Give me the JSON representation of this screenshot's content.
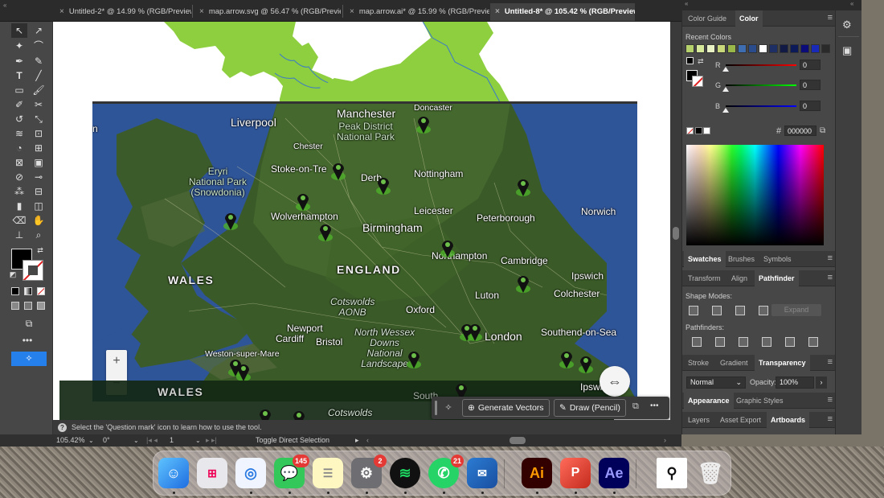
{
  "tabs": [
    {
      "label": "Untitled-2* @ 14.99 % (RGB/Preview)",
      "active": false
    },
    {
      "label": "map.arrow.svg @ 56.47 % (RGB/Preview)",
      "active": false
    },
    {
      "label": "map.arrow.ai* @ 15.99 % (RGB/Preview)",
      "active": false
    },
    {
      "label": "Untitled-8* @ 105.42 % (RGB/Preview)",
      "active": true
    }
  ],
  "tab_close": "×",
  "toolbar": {
    "more": "•••"
  },
  "map": {
    "labels": {
      "manchester": "Manchester",
      "doncaster": "Doncaster",
      "liverpool": "Liverpool",
      "peak": "Peak District\nNational Park",
      "chester": "Chester",
      "snowdonia": "Eryri\nNational Park\n(Snowdonia)",
      "stoke": "Stoke-on-Tre",
      "derby": "Derb",
      "nottingham": "Nottingham",
      "wolverhampton": "Wolverhampton",
      "leicester": "Leicester",
      "peterborough": "Peterborough",
      "norwich": "Norwich",
      "birmingham": "Birmingham",
      "northampton": "Northampton",
      "cambridge": "Cambridge",
      "wales": "WALES",
      "england": "ENGLAND",
      "ipswich": "Ipswich",
      "colchester": "Colchester",
      "luton": "Luton",
      "cotswolds": "Cotswolds\nAONB",
      "oxford": "Oxford",
      "newport": "Newport",
      "cardiff": "Cardiff",
      "bristol": "Bristol",
      "north_wessex": "North Wessex\nDowns\nNational\nLandscape",
      "london": "London",
      "southend": "Southend-on-Sea",
      "weston": "Weston-super-Mare",
      "strip_wales": "WALES",
      "strip_ipswich": "Ipswich",
      "strip_cotswolds": "Cotswolds",
      "strip_south": "South"
    },
    "zoom_plus": "+",
    "zoom_minus": "−",
    "left_edge": "n"
  },
  "context_bar": {
    "generate": "Generate Vectors",
    "draw": "Draw (Pencil)",
    "more": "•••"
  },
  "hint": "Select the 'Question mark' icon to learn how to use the tool.",
  "status": {
    "zoom": "105.42%",
    "rotation": "0°",
    "artboard": "1",
    "tool": "Toggle Direct Selection"
  },
  "panels": {
    "color_tabs": [
      "Color Guide",
      "Color"
    ],
    "recent_colors_label": "Recent Colors",
    "recent_colors": [
      "#b5d16b",
      "#d6e89a",
      "#e8f2c4",
      "#c8d87a",
      "#9ab84a",
      "#3f6db1",
      "#2a4c8c",
      "#ffffff",
      "#1e2f66",
      "#101a44",
      "#0c1a5a",
      "#0b0b7a",
      "#1a2ab8",
      "#2a2a2a"
    ],
    "r_label": "R",
    "g_label": "G",
    "b_label": "B",
    "r": "0",
    "g": "0",
    "b": "0",
    "hex_hash": "#",
    "hex": "000000",
    "swatch_tabs": [
      "Swatches",
      "Brushes",
      "Symbols"
    ],
    "transform_tabs": [
      "Transform",
      "Align",
      "Pathfinder"
    ],
    "shape_modes": "Shape Modes:",
    "expand": "Expand",
    "pathfinders": "Pathfinders:",
    "stroke_tabs": [
      "Stroke",
      "Gradient",
      "Transparency"
    ],
    "blend_mode": "Normal",
    "opacity_label": "Opacity:",
    "opacity": "100%",
    "appearance_tabs": [
      "Appearance",
      "Graphic Styles"
    ],
    "layer_tabs": [
      "Layers",
      "Asset Export",
      "Artboards"
    ]
  },
  "dock": {
    "badges": {
      "messages": "145",
      "settings": "2",
      "whatsapp": "21"
    },
    "ai": "Ai",
    "ae": "Ae",
    "ppt": "P"
  }
}
